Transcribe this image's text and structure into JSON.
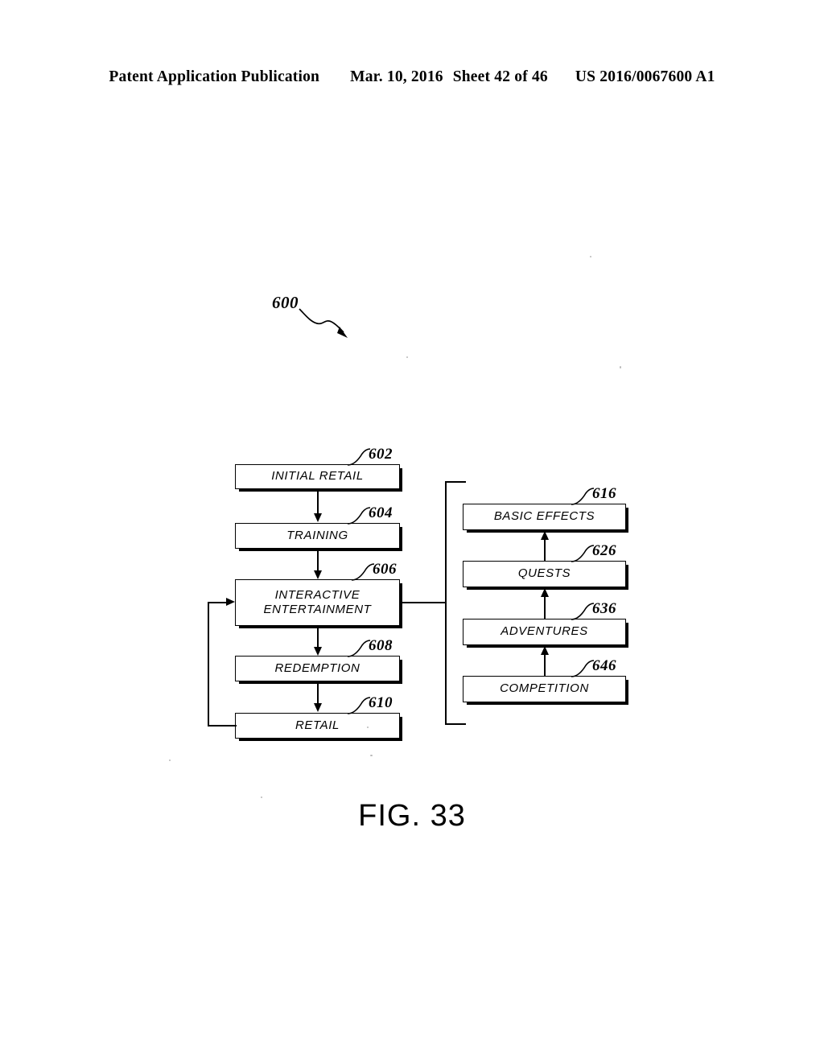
{
  "header": {
    "publication": "Patent Application Publication",
    "date": "Mar. 10, 2016",
    "sheet": "Sheet 42 of 46",
    "patent_number": "US 2016/0067600 A1"
  },
  "figure": {
    "caption": "FIG. 33",
    "diagram_ref": "600",
    "left_column": [
      {
        "ref": "602",
        "label": "INITIAL RETAIL"
      },
      {
        "ref": "604",
        "label": "TRAINING"
      },
      {
        "ref": "606",
        "label": "INTERACTIVE\nENTERTAINMENT"
      },
      {
        "ref": "608",
        "label": "REDEMPTION"
      },
      {
        "ref": "610",
        "label": "RETAIL"
      }
    ],
    "right_column": [
      {
        "ref": "616",
        "label": "BASIC EFFECTS"
      },
      {
        "ref": "626",
        "label": "QUESTS"
      },
      {
        "ref": "636",
        "label": "ADVENTURES"
      },
      {
        "ref": "646",
        "label": "COMPETITION"
      }
    ]
  }
}
